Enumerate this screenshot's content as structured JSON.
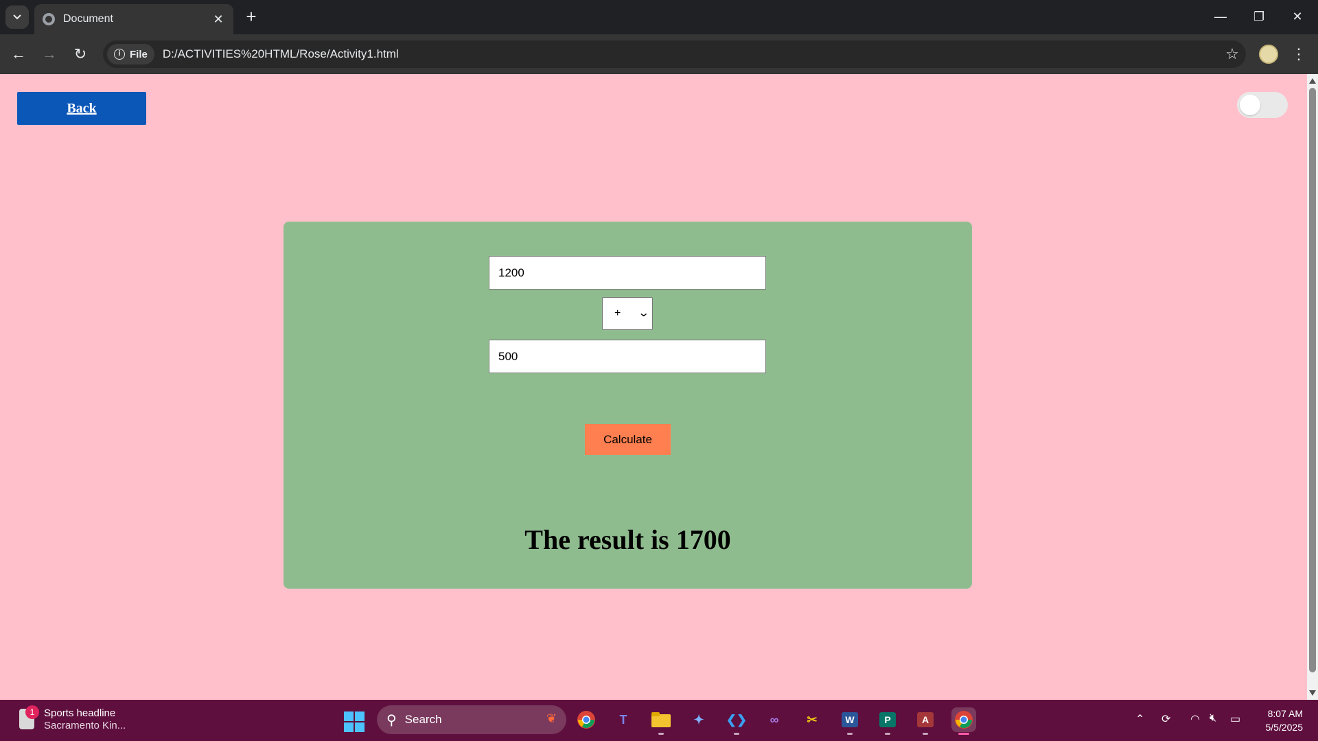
{
  "browser": {
    "tab_title": "Document",
    "tab_close": "✕",
    "new_tab": "+",
    "window_controls": {
      "minimize": "—",
      "restore": "❐",
      "close": "✕"
    },
    "nav": {
      "back": "←",
      "forward": "→",
      "reload": "↻"
    },
    "site_chip": "File",
    "url": "D:/ACTIVITIES%20HTML/Rose/Activity1.html",
    "bookmark_icon": "☆",
    "menu_icon": "⋮"
  },
  "page": {
    "back_label": "Back",
    "toggle_state": "off",
    "calculator": {
      "first_value": "1200",
      "operator": "+",
      "second_value": "500",
      "calculate_label": "Calculate",
      "result_text": "The result is 1700"
    },
    "colors": {
      "background": "#ffc0cb",
      "card": "#8fbc8f",
      "back_button": "#0b57b8",
      "calculate_button": "#ff7f50"
    }
  },
  "taskbar": {
    "widget_title": "Sports headline",
    "widget_subtitle": "Sacramento Kin...",
    "widget_badge": "1",
    "search_placeholder": "Search",
    "apps": [
      "chrome",
      "teams",
      "file-explorer",
      "copilot",
      "vscode",
      "visual-studio",
      "snipping-tool",
      "word",
      "publisher",
      "access",
      "chrome-active"
    ],
    "time": "8:07 AM",
    "date": "5/5/2025"
  }
}
